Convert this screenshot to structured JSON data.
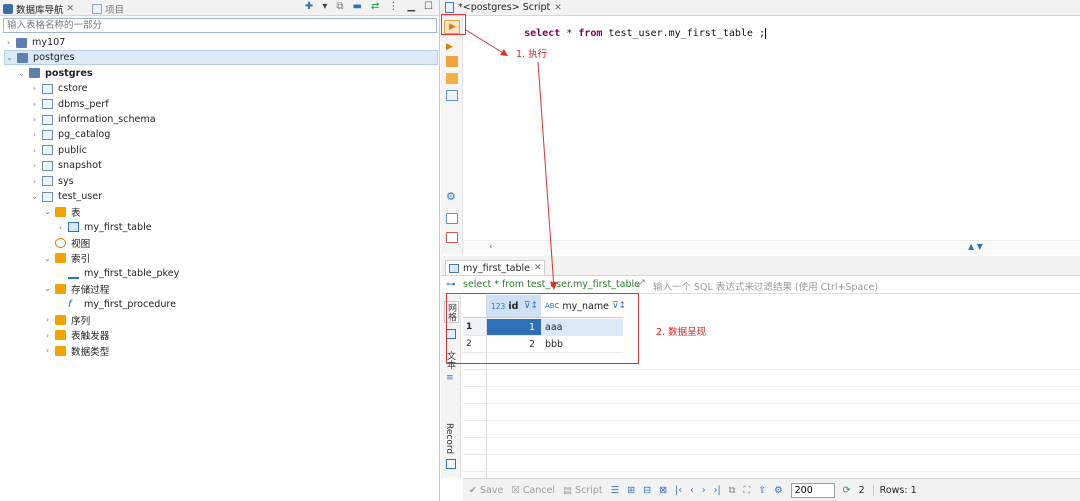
{
  "left_panel": {
    "tabs": [
      {
        "label": "数据库导航"
      },
      {
        "label": "项目"
      }
    ],
    "search_placeholder": "输入表格名称的一部分",
    "tree": [
      {
        "label": "my107",
        "level": 0,
        "expanded": false,
        "icon": "connection-icon"
      },
      {
        "label": "postgres",
        "level": 0,
        "expanded": true,
        "selected": true,
        "icon": "connection-icon"
      },
      {
        "label": "postgres",
        "level": 1,
        "expanded": true,
        "bold": true,
        "icon": "database-icon"
      },
      {
        "label": "cstore",
        "level": 2,
        "expanded": false,
        "icon": "schema-icon"
      },
      {
        "label": "dbms_perf",
        "level": 2,
        "expanded": false,
        "icon": "schema-icon"
      },
      {
        "label": "information_schema",
        "level": 2,
        "expanded": false,
        "icon": "schema-icon"
      },
      {
        "label": "pg_catalog",
        "level": 2,
        "expanded": false,
        "icon": "schema-icon"
      },
      {
        "label": "public",
        "level": 2,
        "expanded": false,
        "icon": "schema-icon"
      },
      {
        "label": "snapshot",
        "level": 2,
        "expanded": false,
        "icon": "schema-icon"
      },
      {
        "label": "sys",
        "level": 2,
        "expanded": false,
        "icon": "schema-icon"
      },
      {
        "label": "test_user",
        "level": 2,
        "expanded": true,
        "icon": "schema-icon"
      },
      {
        "label": "表",
        "level": 3,
        "expanded": true,
        "icon": "table-folder-icon"
      },
      {
        "label": "my_first_table",
        "level": 4,
        "expanded": false,
        "icon": "table-icon"
      },
      {
        "label": "视图",
        "level": 3,
        "expanded": null,
        "icon": "view-icon"
      },
      {
        "label": "索引",
        "level": 3,
        "expanded": true,
        "icon": "folder-icon"
      },
      {
        "label": "my_first_table_pkey",
        "level": 4,
        "expanded": null,
        "icon": "index-icon"
      },
      {
        "label": "存储过程",
        "level": 3,
        "expanded": true,
        "icon": "folder-icon"
      },
      {
        "label": "my_first_procedure",
        "level": 4,
        "expanded": null,
        "icon": "function-icon"
      },
      {
        "label": "序列",
        "level": 3,
        "expanded": false,
        "icon": "folder-icon"
      },
      {
        "label": "表触发器",
        "level": 3,
        "expanded": false,
        "icon": "folder-icon"
      },
      {
        "label": "数据类型",
        "level": 3,
        "expanded": false,
        "icon": "folder-icon"
      }
    ]
  },
  "editor": {
    "tab_label": "*<postgres> Script",
    "sql": [
      "select",
      " * ",
      "from",
      " test_user.my_first_table ;"
    ]
  },
  "results": {
    "tab_label": "my_first_table",
    "filter_query": "select * from test_user.my_first_table",
    "filter_placeholder": "输入一个 SQL 表达式来过滤结果 (使用 Ctrl+Space)",
    "side_tabs": [
      "网格",
      "文本",
      "Record"
    ],
    "columns": [
      {
        "name": "id",
        "type_badge": "123"
      },
      {
        "name": "my_name",
        "type_badge": "ABC"
      }
    ],
    "rows": [
      {
        "num": "1",
        "id": "1",
        "my_name": "aaa"
      },
      {
        "num": "2",
        "id": "2",
        "my_name": "bbb"
      }
    ]
  },
  "status_bar": {
    "save": "Save",
    "cancel": "Cancel",
    "script": "Script",
    "fetch_size": "200",
    "refresh_count": "2",
    "rows": "Rows: 1"
  },
  "annotations": {
    "step1": "1. 执行",
    "step2": "2. 数据呈现",
    "color": "#e02020"
  }
}
